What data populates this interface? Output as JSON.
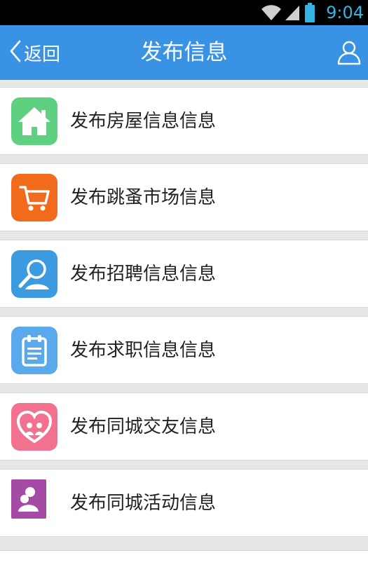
{
  "status_bar": {
    "time": "9:04",
    "wifi_icon": "wifi-icon",
    "signal_icon": "signal-icon",
    "battery_icon": "battery-icon"
  },
  "nav": {
    "back_label": "返回",
    "title": "发布信息",
    "user_icon": "user-icon"
  },
  "colors": {
    "nav_bg": "#3a92e4",
    "house": "#5fcf80",
    "market": "#f26a1b",
    "recruit": "#3b9ae0",
    "job": "#5aa9ec",
    "friend": "#f2718e",
    "activity": "#a44ca5"
  },
  "items": [
    {
      "label": "发布房屋信息信息",
      "icon": "house-icon"
    },
    {
      "label": "发布跳蚤市场信息",
      "icon": "shopping-cart-icon"
    },
    {
      "label": "发布招聘信息信息",
      "icon": "magnifier-person-icon"
    },
    {
      "label": "发布求职信息信息",
      "icon": "clipboard-icon"
    },
    {
      "label": "发布同城交友信息",
      "icon": "heart-people-icon"
    },
    {
      "label": "发布同城活动信息",
      "icon": "activity-people-icon"
    }
  ]
}
